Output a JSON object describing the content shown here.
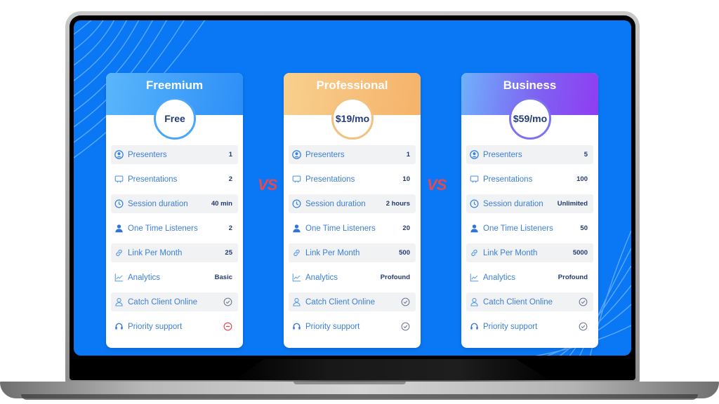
{
  "plans": [
    {
      "name": "Freemium",
      "price": "Free",
      "theme": "free",
      "features": [
        {
          "icon": "user-circle-icon",
          "label": "Presenters",
          "value": "1"
        },
        {
          "icon": "presentation-icon",
          "label": "Presentations",
          "value": "2"
        },
        {
          "icon": "clock-icon",
          "label": "Session duration",
          "value": "40 min"
        },
        {
          "icon": "user-solid-icon",
          "label": "One Time Listeners",
          "value": "2"
        },
        {
          "icon": "link-icon",
          "label": "Link Per Month",
          "value": "25"
        },
        {
          "icon": "chart-line-icon",
          "label": "Analytics",
          "value": "Basic"
        },
        {
          "icon": "user-outline-icon",
          "label": "Catch Client Online",
          "status": "check-icon"
        },
        {
          "icon": "headset-icon",
          "label": "Priority support",
          "status": "minus-circle-icon"
        }
      ]
    },
    {
      "name": "Professional",
      "price": "$19/mo",
      "theme": "pro",
      "features": [
        {
          "icon": "user-circle-icon",
          "label": "Presenters",
          "value": "1"
        },
        {
          "icon": "presentation-icon",
          "label": "Presentations",
          "value": "10"
        },
        {
          "icon": "clock-icon",
          "label": "Session duration",
          "value": "2 hours"
        },
        {
          "icon": "user-solid-icon",
          "label": "One Time Listeners",
          "value": "20"
        },
        {
          "icon": "link-icon",
          "label": "Link Per Month",
          "value": "500"
        },
        {
          "icon": "chart-line-icon",
          "label": "Analytics",
          "value": "Profound"
        },
        {
          "icon": "user-outline-icon",
          "label": "Catch Client Online",
          "status": "check-icon"
        },
        {
          "icon": "headset-icon",
          "label": "Priority support",
          "status": "check-icon"
        }
      ]
    },
    {
      "name": "Business",
      "price": "$59/mo",
      "theme": "biz",
      "features": [
        {
          "icon": "user-circle-icon",
          "label": "Presenters",
          "value": "5"
        },
        {
          "icon": "presentation-icon",
          "label": "Presentations",
          "value": "100"
        },
        {
          "icon": "clock-icon",
          "label": "Session duration",
          "value": "Unlimited"
        },
        {
          "icon": "user-solid-icon",
          "label": "One Time Listeners",
          "value": "50"
        },
        {
          "icon": "link-icon",
          "label": "Link Per Month",
          "value": "5000"
        },
        {
          "icon": "chart-line-icon",
          "label": "Analytics",
          "value": "Profound"
        },
        {
          "icon": "user-outline-icon",
          "label": "Catch Client Online",
          "status": "check-icon"
        },
        {
          "icon": "headset-icon",
          "label": "Priority support",
          "status": "check-icon"
        }
      ]
    }
  ],
  "separator_text": "VS",
  "colors": {
    "screen_bg": "#0a78f5",
    "vs": "#e8474d",
    "label": "#3d7fd8",
    "value": "#233a6e",
    "check": "#6b7791",
    "minus": "#e0484e"
  }
}
